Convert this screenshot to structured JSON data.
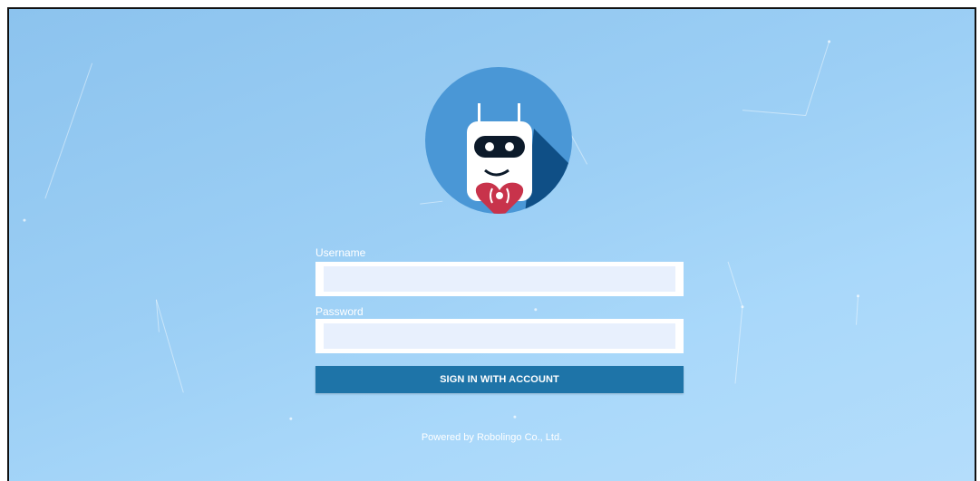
{
  "logo": {
    "icon": "robot-heart-logo-icon",
    "circle_color": "#4a97d6",
    "heart_color": "#c8334b"
  },
  "form": {
    "username_label": "Username",
    "username_value": "",
    "password_label": "Password",
    "password_value": "",
    "signin_label": "SIGN IN WITH ACCOUNT"
  },
  "footer": {
    "text": "Powered by Robolingo Co., Ltd."
  },
  "colors": {
    "button": "#1e74a8",
    "background": "#9ccff5"
  }
}
